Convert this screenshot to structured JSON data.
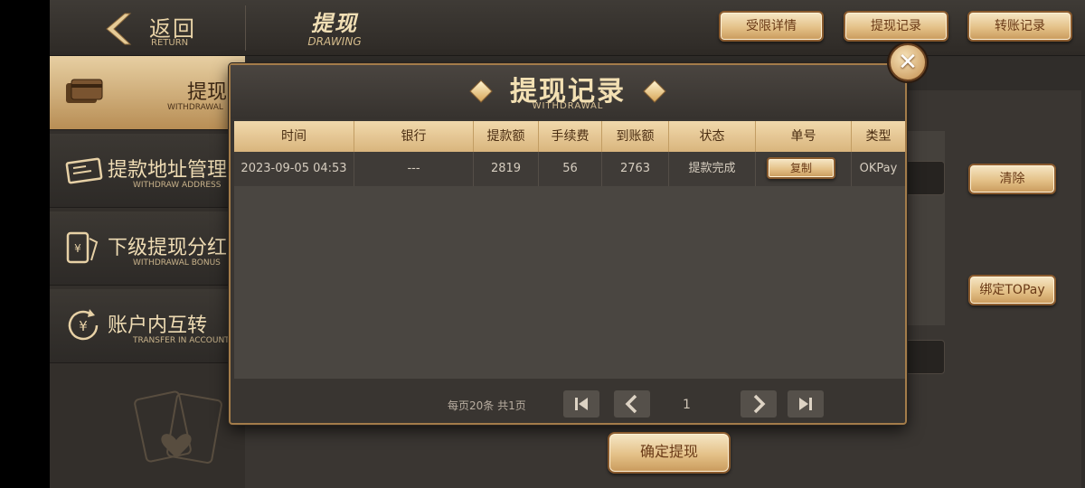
{
  "header": {
    "back_label": "返回",
    "back_sub": "RETURN",
    "title": "提现",
    "title_sub": "DRAWING",
    "buttons": [
      "受限详情",
      "提现记录",
      "转账记录"
    ]
  },
  "sidebar": {
    "items": [
      {
        "label": "提现",
        "sub": "WITHDRAWAL",
        "active": true,
        "icon": "bank-card-icon"
      },
      {
        "label": "提款地址管理",
        "sub": "WITHDRAW ADDRESS",
        "icon": "address-card-icon"
      },
      {
        "label": "下级提现分红",
        "sub": "WITHDRAWAL BONUS",
        "icon": "bonus-phone-icon"
      },
      {
        "label": "账户内互转",
        "sub": "TRANSFER IN ACCOUNT",
        "icon": "yuan-transfer-icon"
      }
    ]
  },
  "background_panel": {
    "clear_label": "清除",
    "bind_label": "绑定TOPay",
    "confirm_label": "确定提现"
  },
  "modal": {
    "title": "提现记录",
    "subtitle": "WITHDRAWAL",
    "columns": [
      "时间",
      "银行",
      "提款额",
      "手续费",
      "到账额",
      "状态",
      "单号",
      "类型"
    ],
    "rows": [
      {
        "time": "2023-09-05 04:53",
        "bank": "---",
        "amount": "2819",
        "fee": "56",
        "received": "2763",
        "status": "提款完成",
        "order_action": "复制",
        "type": "OKPay"
      }
    ],
    "pager": {
      "info": "每页20条 共1页",
      "current_page": "1"
    }
  },
  "colors": {
    "gold_light": "#f1d9ac",
    "gold_dark": "#c99a5c",
    "bg_dark": "#302d2a",
    "text_brown": "#6a3a17"
  }
}
